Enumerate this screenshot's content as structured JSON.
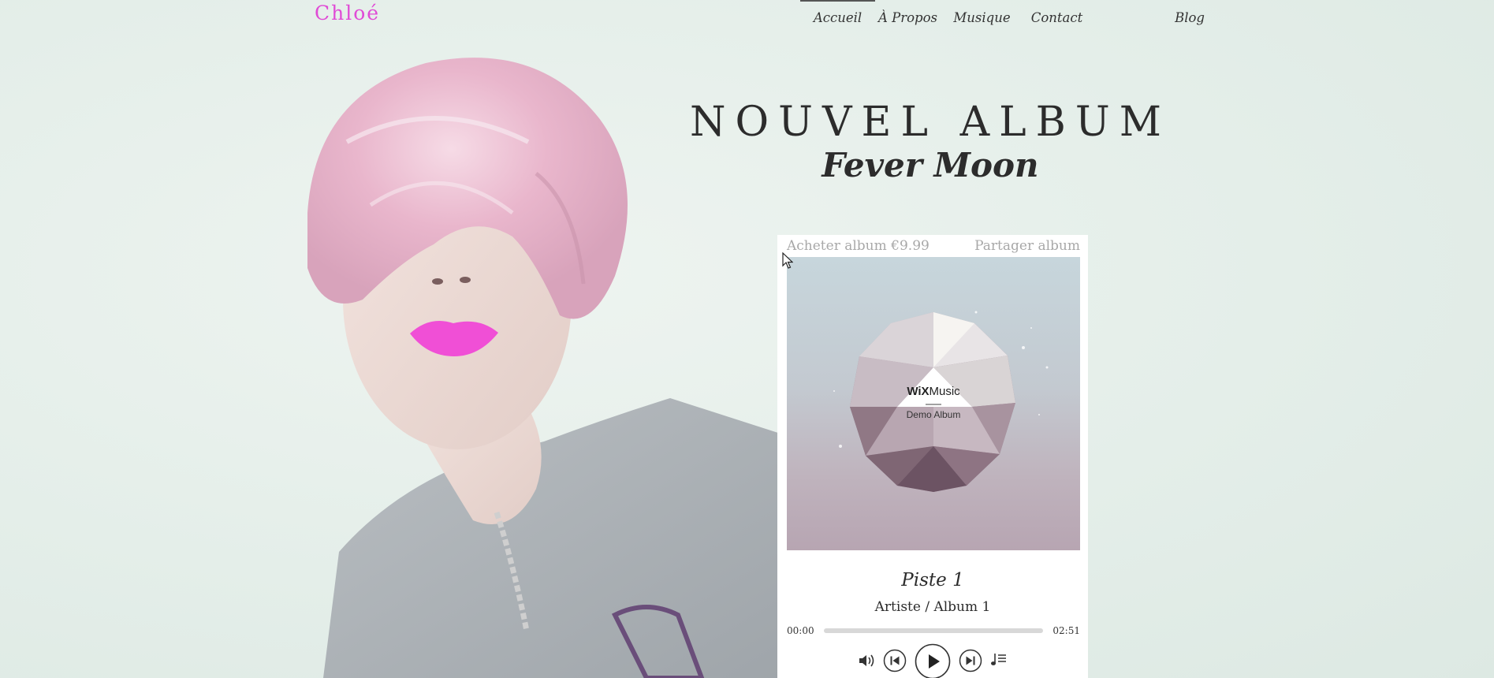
{
  "site": {
    "logo": "Chloé"
  },
  "nav": {
    "items": [
      {
        "label": "Accueil",
        "active": true
      },
      {
        "label": "À Propos",
        "active": false
      },
      {
        "label": "Musique",
        "active": false
      },
      {
        "label": "Contact",
        "active": false
      },
      {
        "label": "Blog",
        "active": false
      }
    ]
  },
  "hero": {
    "headline": "NOUVEL ALBUM",
    "subheadline": "Fever Moon"
  },
  "player": {
    "buy_label": "Acheter album €9.99",
    "share_label": "Partager album",
    "cover": {
      "brand_bold": "WiX",
      "brand_light": "Music",
      "album_label": "Demo Album"
    },
    "track_title": "Piste 1",
    "track_meta": "Artiste / Album 1",
    "time_current": "00:00",
    "time_total": "02:51",
    "progress": 0
  },
  "colors": {
    "logo": "#e04bd6",
    "background": "#e6efea",
    "lips": "#f04fd6"
  },
  "icons": [
    "volume-icon",
    "previous-track-icon",
    "play-icon",
    "next-track-icon",
    "playlist-icon",
    "mouse-cursor-icon"
  ]
}
